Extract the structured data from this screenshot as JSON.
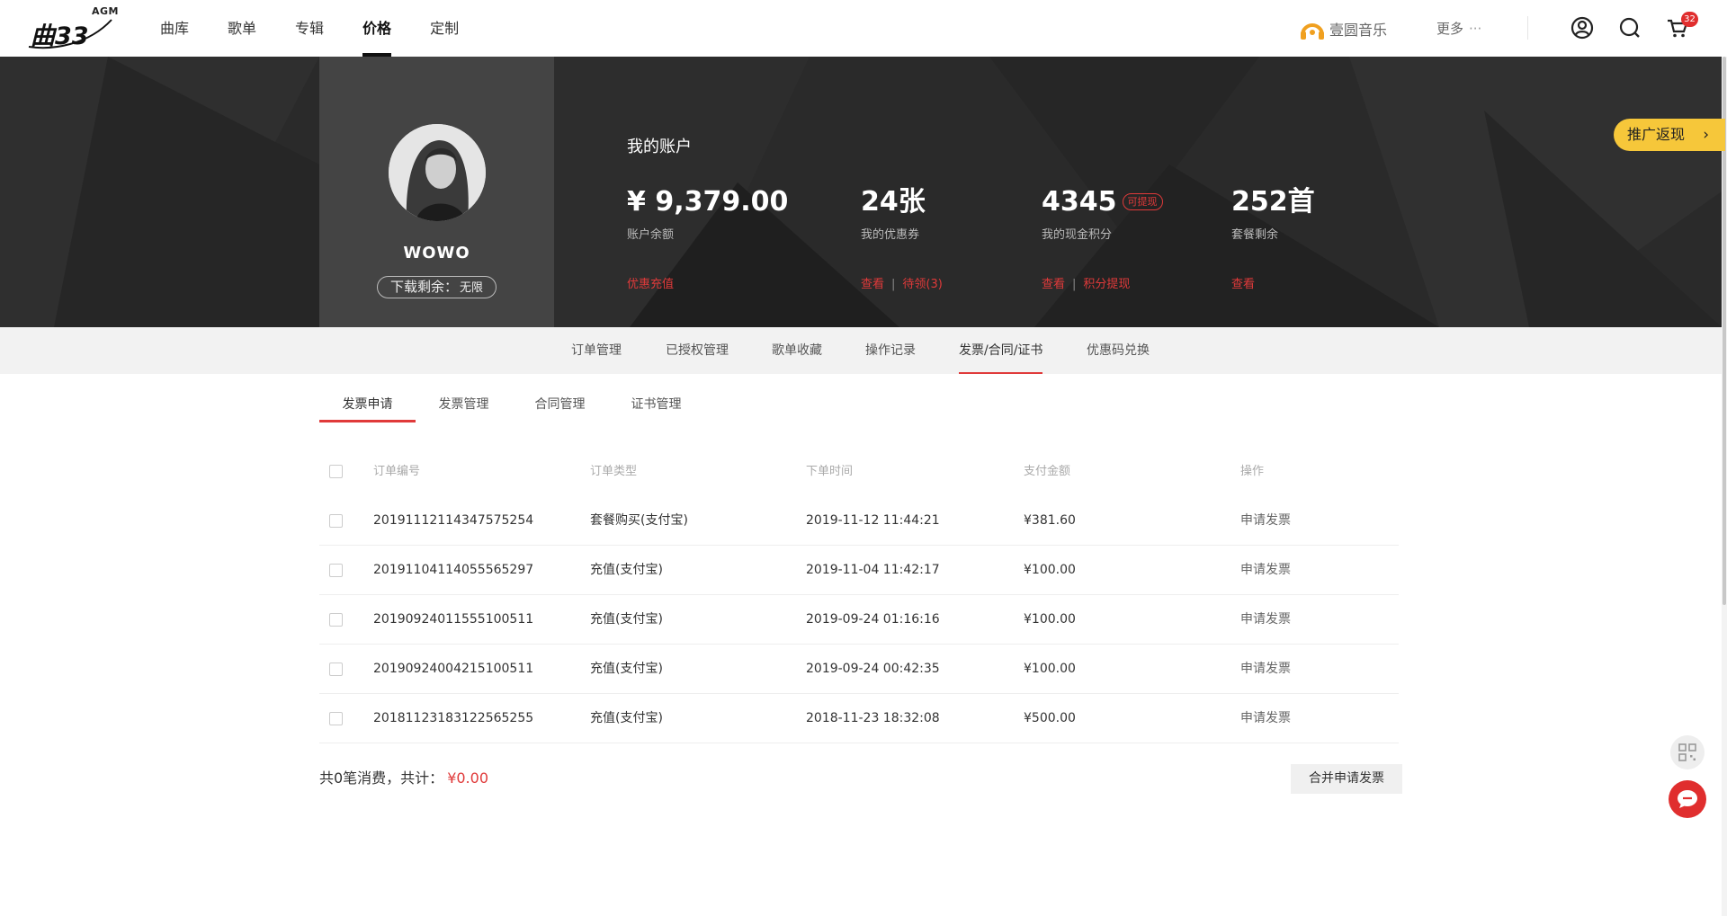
{
  "nav": {
    "logo_mark": "曲33",
    "logo_agm": "AGM",
    "items": [
      {
        "label": "曲库"
      },
      {
        "label": "歌单"
      },
      {
        "label": "专辑"
      },
      {
        "label": "价格"
      },
      {
        "label": "定制"
      }
    ],
    "active_index": 3,
    "brand_label": "壹圆音乐",
    "more_label": "更多",
    "more_dots": "···",
    "cart_count": "32"
  },
  "profile": {
    "username": "WOWO",
    "download_label": "下载剩余：",
    "download_value": "无限"
  },
  "account": {
    "title": "我的账户",
    "balance": {
      "value": "¥ 9,379.00",
      "label": "账户余额",
      "link": "优惠充值"
    },
    "coupons": {
      "value": "24张",
      "label": "我的优惠券",
      "link_view": "查看",
      "link_pending": "待领(3)"
    },
    "points": {
      "value": "4345",
      "tag": "可提现",
      "label": "我的现金积分",
      "link_view": "查看",
      "link_withdraw": "积分提现"
    },
    "package": {
      "value": "252首",
      "label": "套餐剩余",
      "link_view": "查看"
    },
    "sep": "|"
  },
  "promo": {
    "label": "推广返现",
    "chevron": "›"
  },
  "main_tabs": [
    "订单管理",
    "已授权管理",
    "歌单收藏",
    "操作记录",
    "发票/合同/证书",
    "优惠码兑换"
  ],
  "sub_tabs": [
    "发票申请",
    "发票管理",
    "合同管理",
    "证书管理"
  ],
  "table": {
    "headers": [
      "订单编号",
      "订单类型",
      "下单时间",
      "支付金额",
      "操作"
    ],
    "rows": [
      {
        "order_id": "20191112114347575254",
        "type": "套餐购买(支付宝)",
        "time": "2019-11-12 11:44:21",
        "amount": "¥381.60",
        "action": "申请发票"
      },
      {
        "order_id": "20191104114055565297",
        "type": "充值(支付宝)",
        "time": "2019-11-04 11:42:17",
        "amount": "¥100.00",
        "action": "申请发票"
      },
      {
        "order_id": "20190924011555100511",
        "type": "充值(支付宝)",
        "time": "2019-09-24 01:16:16",
        "amount": "¥100.00",
        "action": "申请发票"
      },
      {
        "order_id": "20190924004215100511",
        "type": "充值(支付宝)",
        "time": "2019-09-24 00:42:35",
        "amount": "¥100.00",
        "action": "申请发票"
      },
      {
        "order_id": "20181123183122565255",
        "type": "充值(支付宝)",
        "time": "2018-11-23 18:32:08",
        "amount": "¥500.00",
        "action": "申请发票"
      }
    ]
  },
  "summary": {
    "text": "共0笔消费，共计：",
    "amount": "¥0.00"
  },
  "merge_button": "合并申请发票",
  "colors": {
    "accent": "#e03a3a",
    "promo": "#f6c73a",
    "brand": "#f0a020"
  }
}
